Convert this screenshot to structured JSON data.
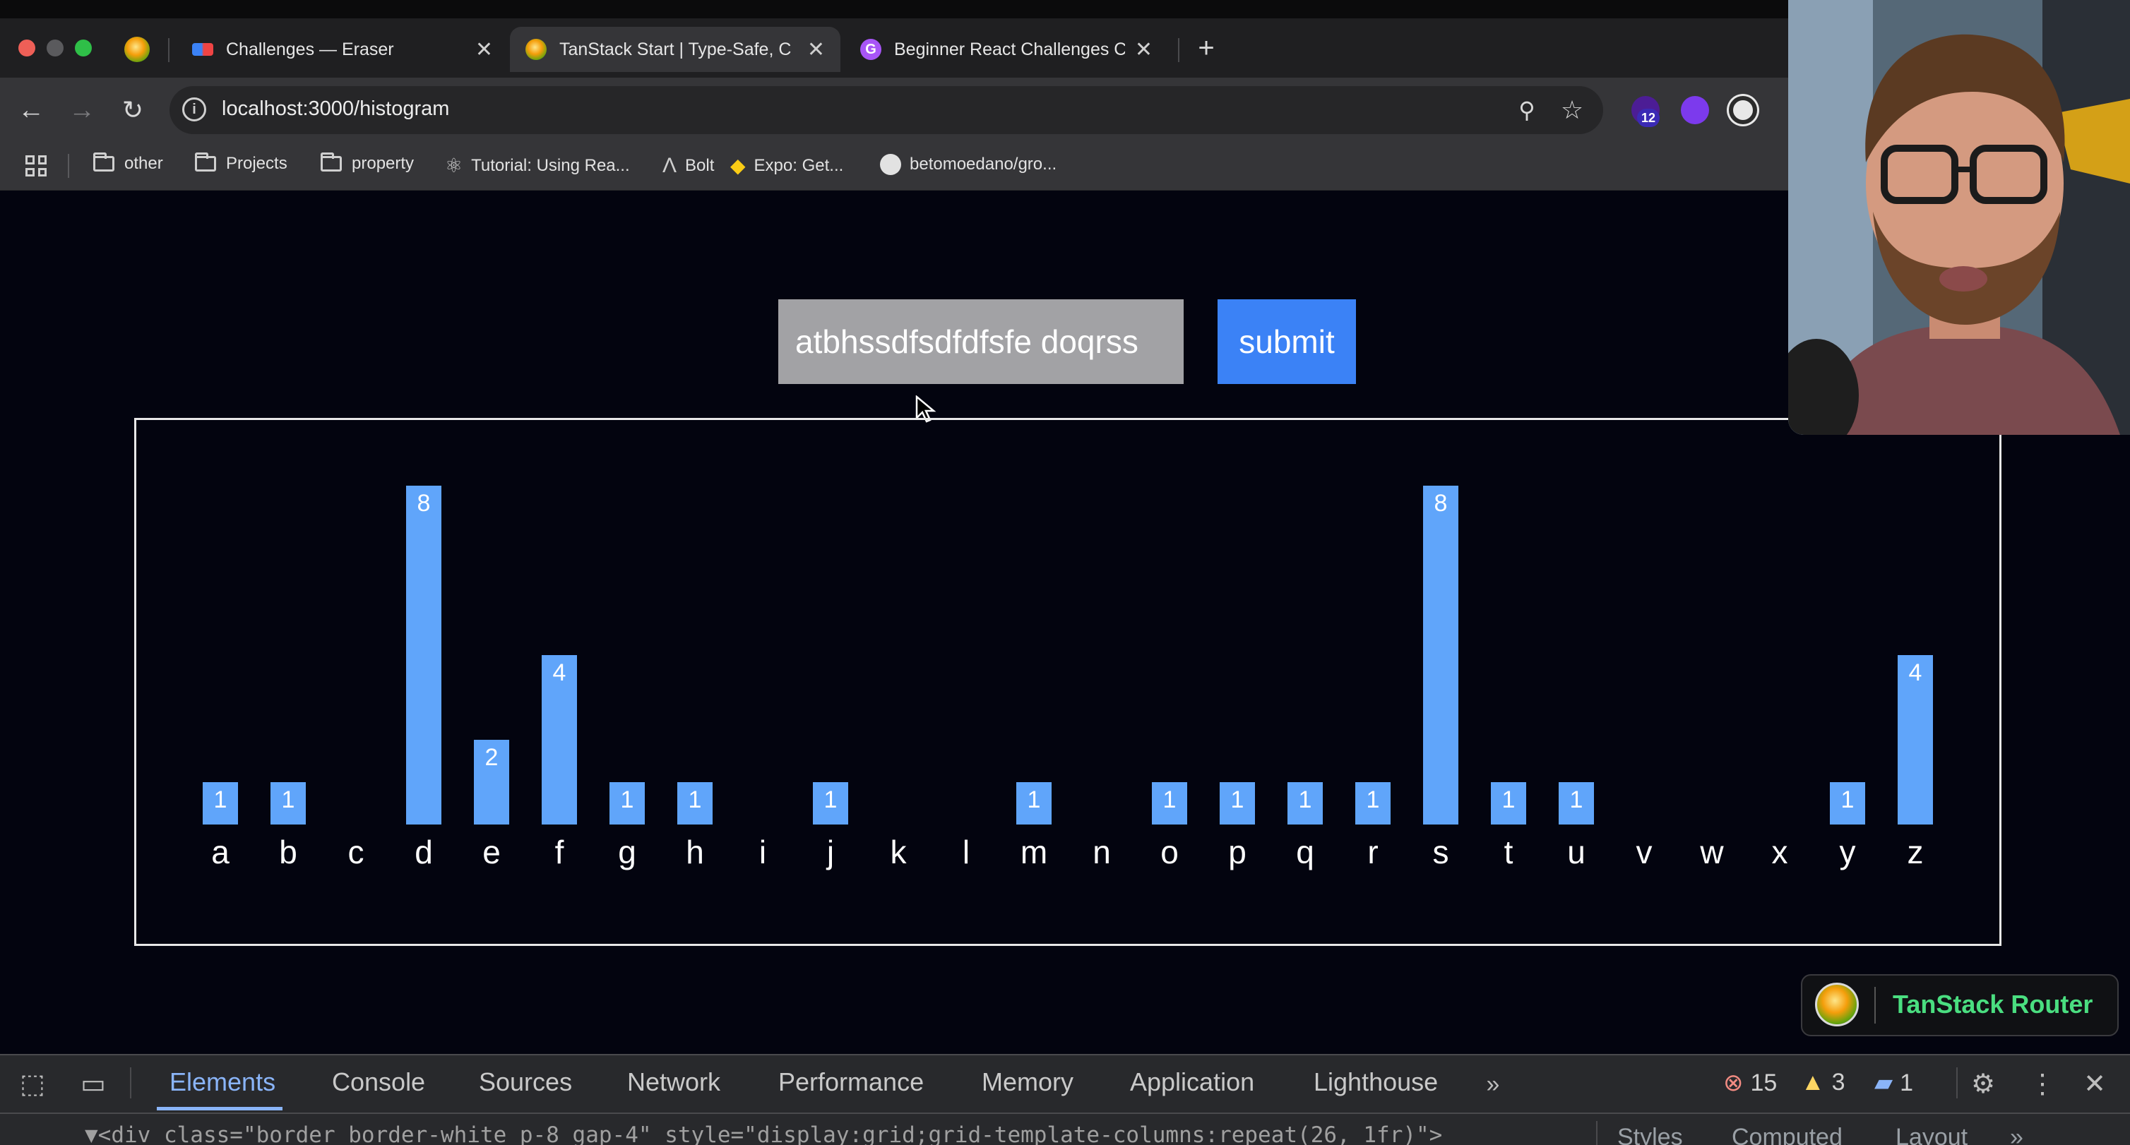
{
  "browser": {
    "tabs": [
      {
        "title": "Challenges — Eraser"
      },
      {
        "title": "TanStack Start | Type-Safe, C"
      },
      {
        "title": "Beginner React Challenges C"
      }
    ],
    "url": "localhost:3000/histogram",
    "extension_badge": "12",
    "bookmarks": [
      {
        "label": "other"
      },
      {
        "label": "Projects"
      },
      {
        "label": "property"
      },
      {
        "label": "Tutorial: Using Rea..."
      },
      {
        "label": "Bolt"
      },
      {
        "label": "Expo: Get..."
      },
      {
        "label": "betomoedano/gro..."
      }
    ]
  },
  "app": {
    "input_value": "atbhssdfsdfdfsfe doqrss",
    "submit_label": "submit",
    "router_label": "TanStack Router"
  },
  "chart_data": {
    "type": "bar",
    "categories": [
      "a",
      "b",
      "c",
      "d",
      "e",
      "f",
      "g",
      "h",
      "i",
      "j",
      "k",
      "l",
      "m",
      "n",
      "o",
      "p",
      "q",
      "r",
      "s",
      "t",
      "u",
      "v",
      "w",
      "x",
      "y",
      "z"
    ],
    "values": [
      1,
      1,
      0,
      8,
      2,
      4,
      1,
      1,
      0,
      1,
      0,
      0,
      1,
      0,
      1,
      1,
      1,
      1,
      8,
      1,
      1,
      0,
      0,
      0,
      1,
      4
    ],
    "ylim": [
      0,
      8
    ],
    "bar_color": "#60a5fa"
  },
  "devtools": {
    "tabs": [
      "Elements",
      "Console",
      "Sources",
      "Network",
      "Performance",
      "Memory",
      "Application",
      "Lighthouse"
    ],
    "error_count": "15",
    "warning_count": "3",
    "message_count": "1",
    "code_line": "▼<div class=\"border border-white p-8 gap-4\" style=\"display:grid;grid-template-columns:repeat(26, 1fr)\">",
    "side_tabs": [
      "Styles",
      "Computed",
      "Layout"
    ]
  },
  "colors": {
    "page_bg": "#03040f",
    "accent": "#3b82f6",
    "bar": "#60a5fa",
    "router_green": "#4ade80",
    "devtools_active": "#8ab4f8"
  }
}
